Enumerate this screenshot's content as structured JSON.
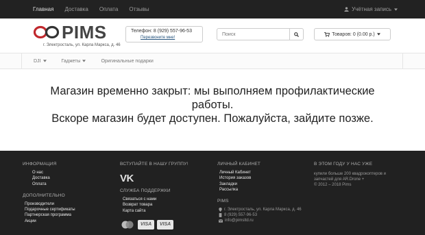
{
  "top_nav": {
    "items": [
      "Главная",
      "Доставка",
      "Оплата",
      "Отзывы"
    ],
    "account": "Учётная запись"
  },
  "header": {
    "logo_text": "PIMS",
    "address": "г. Электросталь, ул. Карла Маркса, д. 46",
    "phone": "Телефон: 8 (929) 557-96-53",
    "callback": "Перезвоните мне!",
    "search_placeholder": "Поиск",
    "cart": "Товаров: 0 (0.00 р.)"
  },
  "menu": {
    "items": [
      "DJI",
      "Гаджеты",
      "Оригинальные подарки"
    ]
  },
  "main": {
    "line1": "Магазин временно закрыт: мы выполняем профилактические",
    "line2": "работы.",
    "line3": "Вскоре магазин будет доступен. Пожалуйста, зайдите позже."
  },
  "footer": {
    "info": {
      "heading": "Информация",
      "items": [
        "О нас",
        "Доставка",
        "Оплата"
      ]
    },
    "extra": {
      "heading": "Дополнительно",
      "items": [
        "Производители",
        "Подарочные сертификаты",
        "Партнерская программа",
        "Акции"
      ]
    },
    "group": {
      "heading": "Вступайте в нашу группу!",
      "vk": "VK"
    },
    "support": {
      "heading": "Служба поддержки",
      "items": [
        "Связаться с нами",
        "Возврат товара",
        "Карта сайта"
      ]
    },
    "payments": {
      "visa1": "VISA",
      "visa2": "VISA"
    },
    "cabinet": {
      "heading": "Личный кабинет",
      "items": [
        "Личный Кабинет",
        "История заказов",
        "Закладки",
        "Рассылка"
      ]
    },
    "pims": {
      "heading": "PIMS",
      "address": "г. Электросталь, ул. Карла Маркса, д. 46",
      "phone": "8 (929) 557-96-53",
      "email": "info@pimsltd.ru"
    },
    "shop": {
      "heading": "В этом году у нас уже",
      "text": "купили больше 200 квадрокоптеров и запчастей для AR.Drone +",
      "copyright": "© 2012 – 2018 Pims"
    }
  },
  "colors": {
    "topbar": "#222222",
    "footer": "#212121",
    "link": "#23527c"
  }
}
